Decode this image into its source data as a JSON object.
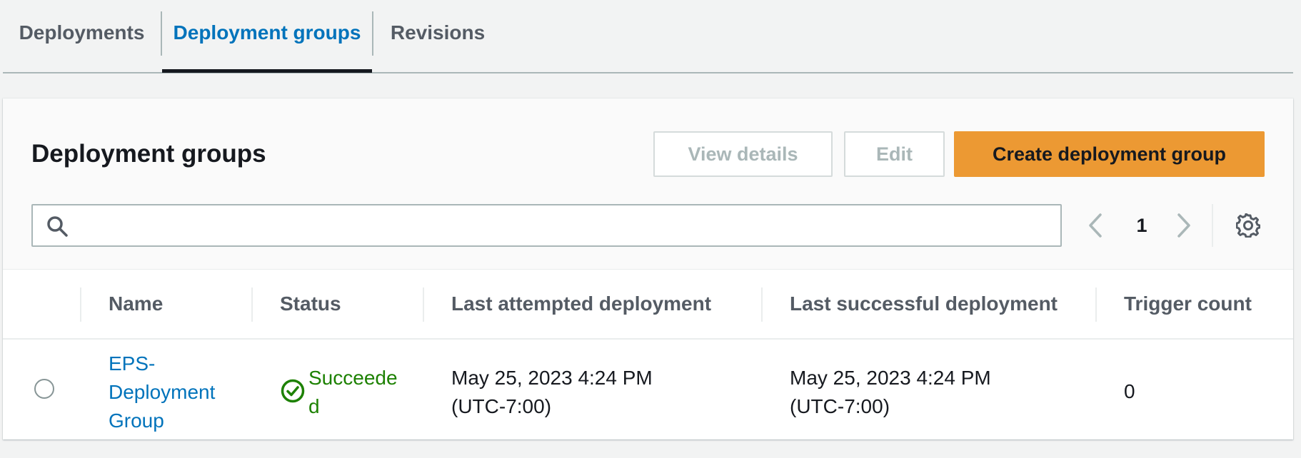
{
  "tabs": [
    {
      "label": "Deployments",
      "active": false
    },
    {
      "label": "Deployment groups",
      "active": true
    },
    {
      "label": "Revisions",
      "active": false
    }
  ],
  "panel": {
    "title": "Deployment groups",
    "buttons": {
      "view_details": "View details",
      "edit": "Edit",
      "create": "Create deployment group"
    },
    "search": {
      "placeholder": "",
      "value": ""
    },
    "pagination": {
      "current_page": "1"
    }
  },
  "table": {
    "columns": [
      "Name",
      "Status",
      "Last attempted deployment",
      "Last successful deployment",
      "Trigger count"
    ],
    "rows": [
      {
        "name": "EPS-Deployment Group",
        "status": "Succeeded",
        "last_attempted": "May 25, 2023 4:24 PM (UTC-7:00)",
        "last_successful": "May 25, 2023 4:24 PM (UTC-7:00)",
        "trigger_count": "0",
        "selected": false
      }
    ]
  },
  "icons": {
    "search": "search-icon",
    "prev": "chevron-left-icon",
    "next": "chevron-right-icon",
    "settings": "gear-icon",
    "status": "check-circle-icon"
  },
  "colors": {
    "link": "#0073bb",
    "primary_button": "#ec9933",
    "success": "#1d8102",
    "muted_text": "#545b64"
  }
}
